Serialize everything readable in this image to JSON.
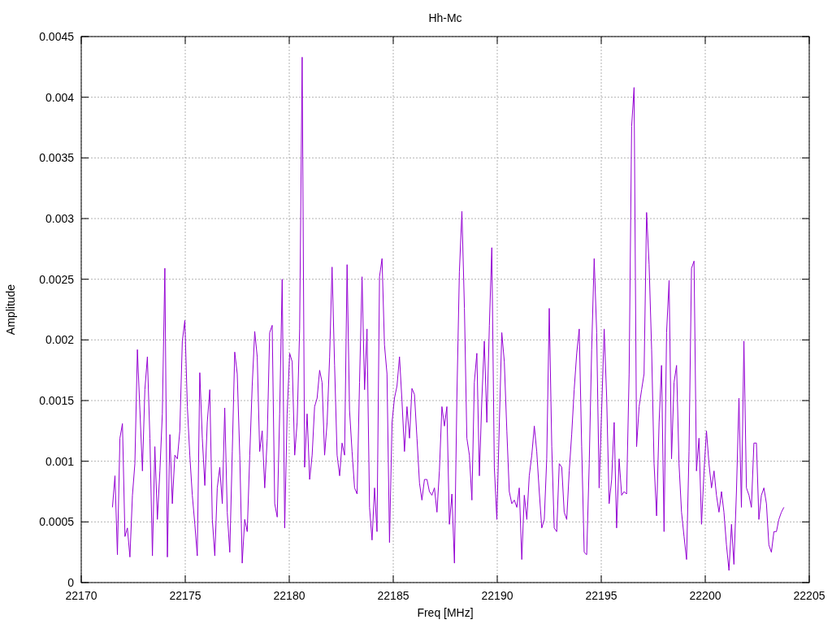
{
  "chart_data": {
    "type": "line",
    "title": "Hh-Mc",
    "xlabel": "Freq [MHz]",
    "ylabel": "Amplitude",
    "xlim": [
      22170,
      22205
    ],
    "ylim": [
      0,
      0.0045
    ],
    "xticks": [
      22170,
      22175,
      22180,
      22185,
      22190,
      22195,
      22200,
      22205
    ],
    "yticks": [
      0,
      0.0005,
      0.001,
      0.0015,
      0.002,
      0.0025,
      0.003,
      0.0035,
      0.004,
      0.0045
    ],
    "x": [
      22171.5,
      22171.62,
      22171.74,
      22171.86,
      22171.98,
      22172.1,
      22172.22,
      22172.34,
      22172.46,
      22172.58,
      22172.7,
      22172.82,
      22172.94,
      22173.06,
      22173.18,
      22173.3,
      22173.42,
      22173.54,
      22173.66,
      22173.78,
      22173.9,
      22174.02,
      22174.14,
      22174.26,
      22174.38,
      22174.5,
      22174.62,
      22174.74,
      22174.86,
      22174.98,
      22175.1,
      22175.22,
      22175.34,
      22175.46,
      22175.58,
      22175.7,
      22175.82,
      22175.94,
      22176.06,
      22176.18,
      22176.3,
      22176.42,
      22176.54,
      22176.66,
      22176.78,
      22176.9,
      22177.02,
      22177.14,
      22177.26,
      22177.38,
      22177.5,
      22177.62,
      22177.74,
      22177.86,
      22177.98,
      22178.1,
      22178.22,
      22178.34,
      22178.46,
      22178.58,
      22178.7,
      22178.82,
      22178.94,
      22179.06,
      22179.18,
      22179.3,
      22179.42,
      22179.54,
      22179.66,
      22179.78,
      22179.9,
      22180.02,
      22180.14,
      22180.26,
      22180.38,
      22180.5,
      22180.62,
      22180.74,
      22180.86,
      22180.98,
      22181.1,
      22181.22,
      22181.34,
      22181.46,
      22181.58,
      22181.7,
      22181.82,
      22181.94,
      22182.06,
      22182.18,
      22182.3,
      22182.42,
      22182.54,
      22182.66,
      22182.78,
      22182.9,
      22183.02,
      22183.14,
      22183.26,
      22183.38,
      22183.5,
      22183.62,
      22183.74,
      22183.86,
      22183.98,
      22184.1,
      22184.22,
      22184.34,
      22184.46,
      22184.58,
      22184.7,
      22184.82,
      22184.94,
      22185.06,
      22185.18,
      22185.3,
      22185.42,
      22185.54,
      22185.66,
      22185.78,
      22185.9,
      22186.02,
      22186.14,
      22186.26,
      22186.38,
      22186.5,
      22186.62,
      22186.74,
      22186.86,
      22186.98,
      22187.1,
      22187.22,
      22187.34,
      22187.46,
      22187.58,
      22187.7,
      22187.82,
      22187.94,
      22188.06,
      22188.18,
      22188.3,
      22188.42,
      22188.54,
      22188.66,
      22188.78,
      22188.9,
      22189.02,
      22189.14,
      22189.26,
      22189.38,
      22189.5,
      22189.62,
      22189.74,
      22189.86,
      22189.98,
      22190.1,
      22190.22,
      22190.34,
      22190.46,
      22190.58,
      22190.7,
      22190.82,
      22190.94,
      22191.06,
      22191.18,
      22191.3,
      22191.42,
      22191.54,
      22191.66,
      22191.78,
      22191.9,
      22192.02,
      22192.14,
      22192.26,
      22192.38,
      22192.5,
      22192.62,
      22192.74,
      22192.86,
      22192.98,
      22193.1,
      22193.22,
      22193.34,
      22193.46,
      22193.58,
      22193.7,
      22193.82,
      22193.94,
      22194.06,
      22194.18,
      22194.3,
      22194.42,
      22194.54,
      22194.66,
      22194.78,
      22194.9,
      22195.02,
      22195.14,
      22195.26,
      22195.38,
      22195.5,
      22195.62,
      22195.74,
      22195.86,
      22195.98,
      22196.1,
      22196.22,
      22196.34,
      22196.46,
      22196.58,
      22196.7,
      22196.82,
      22196.94,
      22197.06,
      22197.18,
      22197.3,
      22197.42,
      22197.54,
      22197.66,
      22197.78,
      22197.9,
      22198.02,
      22198.14,
      22198.26,
      22198.38,
      22198.5,
      22198.62,
      22198.74,
      22198.86,
      22198.98,
      22199.1,
      22199.22,
      22199.34,
      22199.46,
      22199.58,
      22199.7,
      22199.82,
      22199.94,
      22200.06,
      22200.18,
      22200.3,
      22200.42,
      22200.54,
      22200.66,
      22200.78,
      22200.9,
      22201.02,
      22201.14,
      22201.26,
      22201.38,
      22201.5,
      22201.62,
      22201.74,
      22201.86,
      22201.98,
      22202.1,
      22202.22,
      22202.34,
      22202.46,
      22202.58,
      22202.7,
      22202.82,
      22202.94,
      22203.06,
      22203.18,
      22203.3,
      22203.42,
      22203.54,
      22203.66,
      22203.78
    ],
    "grid": true,
    "series": [
      {
        "color": "#9400d3",
        "values": [
          0.00062,
          0.00088,
          0.00023,
          0.00119,
          0.00131,
          0.00038,
          0.00045,
          0.00021,
          0.00072,
          0.00098,
          0.00192,
          0.00142,
          0.00092,
          0.00159,
          0.00186,
          0.00119,
          0.00022,
          0.00112,
          0.00052,
          0.00092,
          0.00139,
          0.00259,
          0.00021,
          0.00122,
          0.00065,
          0.00105,
          0.00102,
          0.00125,
          0.00199,
          0.00216,
          0.00145,
          0.00105,
          0.00072,
          0.00048,
          0.00022,
          0.00173,
          0.00119,
          0.0008,
          0.00132,
          0.00159,
          0.00052,
          0.00022,
          0.00078,
          0.00095,
          0.00065,
          0.00144,
          0.00058,
          0.00025,
          0.00108,
          0.0019,
          0.00172,
          0.00105,
          0.00016,
          0.00052,
          0.00042,
          0.00105,
          0.00162,
          0.00207,
          0.00186,
          0.00108,
          0.00125,
          0.00078,
          0.00119,
          0.00206,
          0.00212,
          0.00065,
          0.00054,
          0.00139,
          0.0025,
          0.00045,
          0.00139,
          0.00189,
          0.00182,
          0.00105,
          0.00132,
          0.00209,
          0.00433,
          0.00095,
          0.00139,
          0.00085,
          0.00105,
          0.00145,
          0.00152,
          0.00175,
          0.00165,
          0.00105,
          0.00132,
          0.00186,
          0.0026,
          0.00179,
          0.00105,
          0.00088,
          0.00115,
          0.00105,
          0.00262,
          0.00142,
          0.00108,
          0.00078,
          0.00073,
          0.00165,
          0.00252,
          0.00159,
          0.00209,
          0.00062,
          0.00035,
          0.00078,
          0.00042,
          0.00252,
          0.00267,
          0.00196,
          0.00172,
          0.00033,
          0.00132,
          0.00152,
          0.00162,
          0.00186,
          0.00149,
          0.00108,
          0.00145,
          0.00119,
          0.0016,
          0.00155,
          0.00119,
          0.00082,
          0.00068,
          0.00085,
          0.00085,
          0.00075,
          0.00072,
          0.00078,
          0.00058,
          0.00092,
          0.00145,
          0.00129,
          0.00145,
          0.00048,
          0.00073,
          0.00016,
          0.00152,
          0.00256,
          0.00306,
          0.00226,
          0.00119,
          0.00105,
          0.00068,
          0.00165,
          0.00189,
          0.00088,
          0.00152,
          0.00199,
          0.00132,
          0.00212,
          0.00276,
          0.00095,
          0.00052,
          0.00132,
          0.00206,
          0.00182,
          0.00125,
          0.00075,
          0.00065,
          0.00068,
          0.00062,
          0.00078,
          0.00019,
          0.00072,
          0.00052,
          0.00088,
          0.00105,
          0.00129,
          0.00108,
          0.00075,
          0.00045,
          0.00052,
          0.00102,
          0.00226,
          0.00112,
          0.00045,
          0.00042,
          0.00098,
          0.00095,
          0.00058,
          0.00052,
          0.00092,
          0.00122,
          0.00159,
          0.00189,
          0.00209,
          0.00112,
          0.00025,
          0.00023,
          0.00098,
          0.00192,
          0.00267,
          0.00206,
          0.00078,
          0.00142,
          0.00209,
          0.00152,
          0.00065,
          0.00085,
          0.00132,
          0.00045,
          0.00102,
          0.00072,
          0.00075,
          0.00073,
          0.00172,
          0.00376,
          0.00408,
          0.00112,
          0.00145,
          0.00159,
          0.00172,
          0.00305,
          0.00262,
          0.00192,
          0.00098,
          0.00055,
          0.00132,
          0.00179,
          0.00042,
          0.00206,
          0.00249,
          0.00102,
          0.00165,
          0.00179,
          0.00098,
          0.00058,
          0.00038,
          0.00019,
          0.00108,
          0.00259,
          0.00265,
          0.00092,
          0.00119,
          0.00048,
          0.00092,
          0.00125,
          0.00098,
          0.00078,
          0.00092,
          0.00072,
          0.00058,
          0.00075,
          0.00058,
          0.00031,
          0.0001,
          0.00048,
          0.00015,
          0.00075,
          0.00152,
          0.00062,
          0.00199,
          0.00078,
          0.00072,
          0.00062,
          0.00115,
          0.00115,
          0.00052,
          0.00072,
          0.00078,
          0.00065,
          0.00031,
          0.00025,
          0.00042,
          0.00042,
          0.00052,
          0.00058,
          0.00062
        ]
      }
    ]
  }
}
